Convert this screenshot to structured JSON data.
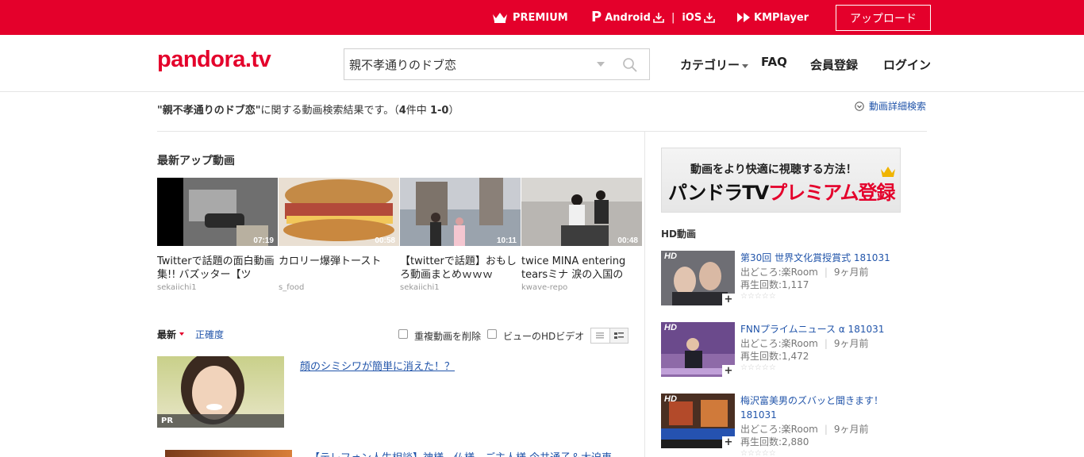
{
  "topbar": {
    "premium": "PREMIUM",
    "android": "Android",
    "ios": "iOS",
    "divider": "|",
    "kmplayer": "KMPlayer",
    "upload": "アップロード"
  },
  "header": {
    "logo": "pandora.tv",
    "search_value": "親不孝通りのドブ恋",
    "nav": {
      "category": "カテゴリー",
      "faq": "FAQ",
      "member": "会員登録",
      "login": "ログイン"
    }
  },
  "result": {
    "query": "\"親不孝通りのドブ恋\"",
    "text": "に関する動画検索結果です。（",
    "count": "4",
    "count_suffix": "件中 ",
    "range": "1-0",
    "close": "）",
    "detail_search": "動画詳細検索"
  },
  "latest": {
    "title": "最新アップ動画",
    "items": [
      {
        "title": "Twitterで話題の面白動画集!! バズッター【ツ",
        "user": "sekaiichi1",
        "duration": "07:19"
      },
      {
        "title": "カロリー爆弾トースト",
        "user": "s_food",
        "duration": "00:58"
      },
      {
        "title": "【twitterで話題】おもしろ動画まとめｗｗｗ",
        "user": "sekaiichi1",
        "duration": "10:11"
      },
      {
        "title": "twice MINA entering tearsミナ 涙の入国の",
        "user": "kwave-repo",
        "duration": "00:48"
      }
    ]
  },
  "sort": {
    "latest": "最新",
    "accuracy": "正確度",
    "dedupe": "重複動画を削除",
    "hd_view": "ビューのHDビデオ"
  },
  "list": {
    "pr_badge": "PR",
    "pr_title": "顔のシミシワが簡単に消えた！？",
    "item2_title": "【テレフォン人生相談】神様、仏様、ご主人様 今井通子＆大迫恵"
  },
  "ad": {
    "line1": "動画をより快適に視聴する方法！",
    "line2_a": "パンドラTV",
    "line2_b": "プレミアム登録"
  },
  "hd": {
    "title": "HD動画",
    "badge": "HD",
    "plus": "+",
    "items": [
      {
        "title": "第30回 世界文化賞授賞式 181031",
        "source": "出どころ:楽Room",
        "age": "9ヶ月前",
        "views": "再生回数:1,117",
        "stars": "☆☆☆☆☆"
      },
      {
        "title": "FNNプライムニュース α 181031",
        "source": "出どころ:楽Room",
        "age": "9ヶ月前",
        "views": "再生回数:1,472",
        "stars": "☆☆☆☆☆"
      },
      {
        "title": "梅沢富美男のズバッと聞きます！ 181031",
        "source": "出どころ:楽Room",
        "age": "9ヶ月前",
        "views": "再生回数:2,880",
        "stars": "☆☆☆☆☆"
      }
    ]
  },
  "colors": {
    "brand": "#e4002b",
    "link": "#2255aa"
  }
}
